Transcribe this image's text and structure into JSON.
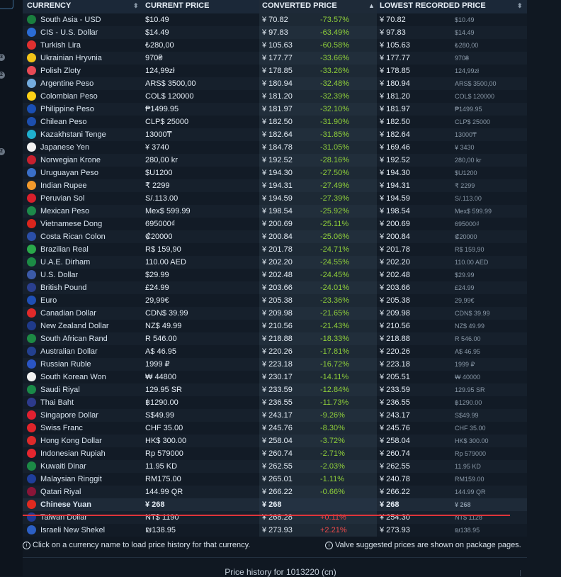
{
  "gutter_badges": [
    "3",
    "2",
    "2"
  ],
  "header": {
    "currency": "CURRENCY",
    "current_price": "CURRENT PRICE",
    "converted_price": "CONVERTED PRICE",
    "lowest_recorded": "LOWEST RECORDED PRICE",
    "sort_both": "⬍",
    "sort_up": "▲"
  },
  "rows": [
    {
      "name": "South Asia - USD",
      "color": "#1a7f3e",
      "price": "$10.49",
      "conv": "¥ 70.82",
      "pct": "-73.57%",
      "low": "¥ 70.82",
      "low_local": "$10.49"
    },
    {
      "name": "CIS - U.S. Dollar",
      "color": "#2b6cd4",
      "price": "$14.49",
      "conv": "¥ 97.83",
      "pct": "-63.49%",
      "low": "¥ 97.83",
      "low_local": "$14.49"
    },
    {
      "name": "Turkish Lira",
      "color": "#e03030",
      "price": "₺280,00",
      "conv": "¥ 105.63",
      "pct": "-60.58%",
      "low": "¥ 105.63",
      "low_local": "₺280,00"
    },
    {
      "name": "Ukrainian Hryvnia",
      "color": "#f2c418",
      "price": "970₴",
      "conv": "¥ 177.77",
      "pct": "-33.66%",
      "low": "¥ 177.77",
      "low_local": "970₴"
    },
    {
      "name": "Polish Zloty",
      "color": "#e84a55",
      "price": "124,99zł",
      "conv": "¥ 178.85",
      "pct": "-33.26%",
      "low": "¥ 178.85",
      "low_local": "124,99zł"
    },
    {
      "name": "Argentine Peso",
      "color": "#74acdf",
      "price": "ARS$ 3500,00",
      "conv": "¥ 180.94",
      "pct": "-32.48%",
      "low": "¥ 180.94",
      "low_local": "ARS$ 3500,00"
    },
    {
      "name": "Colombian Peso",
      "color": "#fcd116",
      "price": "COL$ 120000",
      "conv": "¥ 181.20",
      "pct": "-32.39%",
      "low": "¥ 181.20",
      "low_local": "COL$ 120000"
    },
    {
      "name": "Philippine Peso",
      "color": "#1a4fb4",
      "price": "₱1499.95",
      "conv": "¥ 181.97",
      "pct": "-32.10%",
      "low": "¥ 181.97",
      "low_local": "₱1499.95"
    },
    {
      "name": "Chilean Peso",
      "color": "#1d4fae",
      "price": "CLP$ 25000",
      "conv": "¥ 182.50",
      "pct": "-31.90%",
      "low": "¥ 182.50",
      "low_local": "CLP$ 25000"
    },
    {
      "name": "Kazakhstani Tenge",
      "color": "#1fb0d0",
      "price": "13000₸",
      "conv": "¥ 182.64",
      "pct": "-31.85%",
      "low": "¥ 182.64",
      "low_local": "13000₸"
    },
    {
      "name": "Japanese Yen",
      "color": "#f2f2f2",
      "price": "¥ 3740",
      "conv": "¥ 184.78",
      "pct": "-31.05%",
      "low": "¥ 169.46",
      "low_local": "¥ 3430"
    },
    {
      "name": "Norwegian Krone",
      "color": "#c8202e",
      "price": "280,00 kr",
      "conv": "¥ 192.52",
      "pct": "-28.16%",
      "low": "¥ 192.52",
      "low_local": "280,00 kr"
    },
    {
      "name": "Uruguayan Peso",
      "color": "#3a6fc8",
      "price": "$U1200",
      "conv": "¥ 194.30",
      "pct": "-27.50%",
      "low": "¥ 194.30",
      "low_local": "$U1200"
    },
    {
      "name": "Indian Rupee",
      "color": "#f39a2c",
      "price": "₹ 2299",
      "conv": "¥ 194.31",
      "pct": "-27.49%",
      "low": "¥ 194.31",
      "low_local": "₹ 2299"
    },
    {
      "name": "Peruvian Sol",
      "color": "#d81f2b",
      "price": "S/.113.00",
      "conv": "¥ 194.59",
      "pct": "-27.39%",
      "low": "¥ 194.59",
      "low_local": "S/.113.00"
    },
    {
      "name": "Mexican Peso",
      "color": "#1d8a4a",
      "price": "Mex$ 599.99",
      "conv": "¥ 198.54",
      "pct": "-25.92%",
      "low": "¥ 198.54",
      "low_local": "Mex$ 599.99"
    },
    {
      "name": "Vietnamese Dong",
      "color": "#da251d",
      "price": "695000₫",
      "conv": "¥ 200.69",
      "pct": "-25.11%",
      "low": "¥ 200.69",
      "low_local": "695000₫"
    },
    {
      "name": "Costa Rican Colon",
      "color": "#2b4fa8",
      "price": "₡20000",
      "conv": "¥ 200.84",
      "pct": "-25.06%",
      "low": "¥ 200.84",
      "low_local": "₡20000"
    },
    {
      "name": "Brazilian Real",
      "color": "#2aa84a",
      "price": "R$ 159,90",
      "conv": "¥ 201.78",
      "pct": "-24.71%",
      "low": "¥ 201.78",
      "low_local": "R$ 159,90"
    },
    {
      "name": "U.A.E. Dirham",
      "color": "#1c8a45",
      "price": "110.00 AED",
      "conv": "¥ 202.20",
      "pct": "-24.55%",
      "low": "¥ 202.20",
      "low_local": "110.00 AED"
    },
    {
      "name": "U.S. Dollar",
      "color": "#3b5aa8",
      "price": "$29.99",
      "conv": "¥ 202.48",
      "pct": "-24.45%",
      "low": "¥ 202.48",
      "low_local": "$29.99"
    },
    {
      "name": "British Pound",
      "color": "#2a3f8f",
      "price": "£24.99",
      "conv": "¥ 203.66",
      "pct": "-24.01%",
      "low": "¥ 203.66",
      "low_local": "£24.99"
    },
    {
      "name": "Euro",
      "color": "#1f4fb5",
      "price": "29,99€",
      "conv": "¥ 205.38",
      "pct": "-23.36%",
      "low": "¥ 205.38",
      "low_local": "29,99€"
    },
    {
      "name": "Canadian Dollar",
      "color": "#e12a2a",
      "price": "CDN$ 39.99",
      "conv": "¥ 209.98",
      "pct": "-21.65%",
      "low": "¥ 209.98",
      "low_local": "CDN$ 39.99"
    },
    {
      "name": "New Zealand Dollar",
      "color": "#1f3a8a",
      "price": "NZ$ 49.99",
      "conv": "¥ 210.56",
      "pct": "-21.43%",
      "low": "¥ 210.56",
      "low_local": "NZ$ 49.99"
    },
    {
      "name": "South African Rand",
      "color": "#1d8a44",
      "price": "R 546.00",
      "conv": "¥ 218.88",
      "pct": "-18.33%",
      "low": "¥ 218.88",
      "low_local": "R 546.00"
    },
    {
      "name": "Australian Dollar",
      "color": "#23408f",
      "price": "A$ 46.95",
      "conv": "¥ 220.26",
      "pct": "-17.81%",
      "low": "¥ 220.26",
      "low_local": "A$ 46.95"
    },
    {
      "name": "Russian Ruble",
      "color": "#2a55c4",
      "price": "1999 ₽",
      "conv": "¥ 223.18",
      "pct": "-16.72%",
      "low": "¥ 223.18",
      "low_local": "1999 ₽"
    },
    {
      "name": "South Korean Won",
      "color": "#f2f2f2",
      "price": "₩ 44800",
      "conv": "¥ 230.17",
      "pct": "-14.11%",
      "low": "¥ 205.51",
      "low_local": "₩ 40000"
    },
    {
      "name": "Saudi Riyal",
      "color": "#1a8a48",
      "price": "129.95 SR",
      "conv": "¥ 233.59",
      "pct": "-12.84%",
      "low": "¥ 233.59",
      "low_local": "129.95 SR"
    },
    {
      "name": "Thai Baht",
      "color": "#2d3a8c",
      "price": "฿1290.00",
      "conv": "¥ 236.55",
      "pct": "-11.73%",
      "low": "¥ 236.55",
      "low_local": "฿1290.00"
    },
    {
      "name": "Singapore Dollar",
      "color": "#e02030",
      "price": "S$49.99",
      "conv": "¥ 243.17",
      "pct": "-9.26%",
      "low": "¥ 243.17",
      "low_local": "S$49.99"
    },
    {
      "name": "Swiss Franc",
      "color": "#e0242a",
      "price": "CHF 35.00",
      "conv": "¥ 245.76",
      "pct": "-8.30%",
      "low": "¥ 245.76",
      "low_local": "CHF 35.00"
    },
    {
      "name": "Hong Kong Dollar",
      "color": "#de2a2a",
      "price": "HK$ 300.00",
      "conv": "¥ 258.04",
      "pct": "-3.72%",
      "low": "¥ 258.04",
      "low_local": "HK$ 300.00"
    },
    {
      "name": "Indonesian Rupiah",
      "color": "#e5262f",
      "price": "Rp 579000",
      "conv": "¥ 260.74",
      "pct": "-2.71%",
      "low": "¥ 260.74",
      "low_local": "Rp 579000"
    },
    {
      "name": "Kuwaiti Dinar",
      "color": "#1c8a46",
      "price": "11.95 KD",
      "conv": "¥ 262.55",
      "pct": "-2.03%",
      "low": "¥ 262.55",
      "low_local": "11.95 KD"
    },
    {
      "name": "Malaysian Ringgit",
      "color": "#1f3e9a",
      "price": "RM175.00",
      "conv": "¥ 265.01",
      "pct": "-1.11%",
      "low": "¥ 240.78",
      "low_local": "RM159.00"
    },
    {
      "name": "Qatari Riyal",
      "color": "#8a1538",
      "price": "144.99 QR",
      "conv": "¥ 266.22",
      "pct": "-0.66%",
      "low": "¥ 266.22",
      "low_local": "144.99 QR"
    },
    {
      "name": "Chinese Yuan",
      "color": "#e02a20",
      "price": "¥ 268",
      "conv": "¥ 268",
      "pct": "",
      "low": "¥ 268",
      "low_local": "¥ 268",
      "highlight": true
    },
    {
      "name": "Taiwan Dollar",
      "color": "#1f3a96",
      "price": "NT$ 1190",
      "conv": "¥ 268.28",
      "pct": "+0.11%",
      "low": "¥ 254.30",
      "low_local": "NT$ 1128",
      "pos": true
    },
    {
      "name": "Israeli New Shekel",
      "color": "#2c5fc4",
      "price": "₪138.95",
      "conv": "¥ 273.93",
      "pct": "+2.21%",
      "low": "¥ 273.93",
      "low_local": "₪138.95",
      "pos": true
    }
  ],
  "footer": {
    "left": "Click on a currency name to load price history for that currency.",
    "right": "Valve suggested prices are shown on package pages."
  },
  "next_section_title": "Price history for 1013220 (cn)",
  "colors": {
    "positive": "#8fcf3a",
    "negative": "#f04a4a",
    "highlight_line": "#e0343a"
  }
}
